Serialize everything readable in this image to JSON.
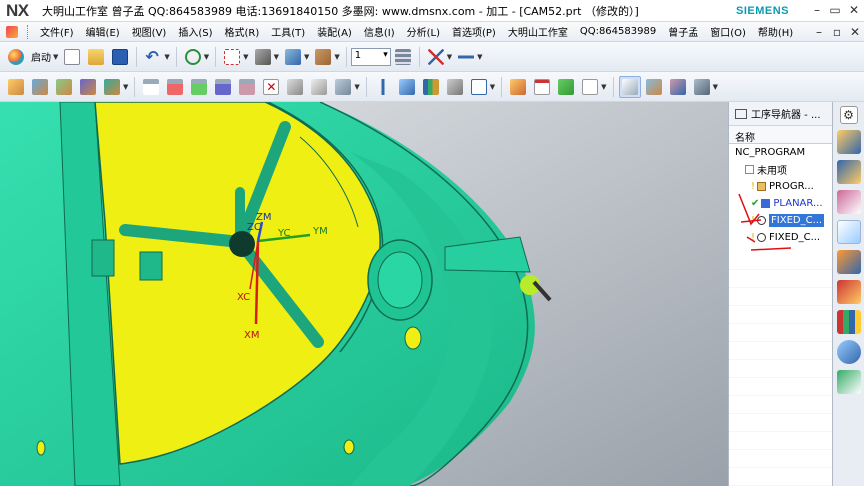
{
  "titlebar": {
    "logo": "NX",
    "title": "大明山工作室 曾子孟 QQ:864583989 电话:13691840150 多墨网: www.dmsnx.com - 加工 - [CAM52.prt （修改的）]",
    "brand": "SIEMENS",
    "min": "–",
    "restore": "▭",
    "close": "✕"
  },
  "menubar": {
    "items": [
      "文件(F)",
      "编辑(E)",
      "视图(V)",
      "插入(S)",
      "格式(R)",
      "工具(T)",
      "装配(A)",
      "信息(I)",
      "分析(L)",
      "首选项(P)",
      "大明山工作室",
      "QQ:864583989",
      "曾子孟",
      "窗口(O)",
      "帮助(H)"
    ],
    "win_min": "–",
    "win_restore": "▫",
    "win_close": "✕"
  },
  "toolbar": {
    "start_label": "启动",
    "layer_value": "1"
  },
  "viewport": {
    "axes": {
      "zm": "ZM",
      "zc": "ZC",
      "yc": "YC",
      "ym": "YM",
      "xc": "XC",
      "xm": "XM"
    }
  },
  "navigator": {
    "title": "工序导航器 - ...",
    "column": "名称",
    "items": [
      {
        "label": "NC_PROGRAM",
        "level": 0,
        "color": "#000000"
      },
      {
        "label": "未用项",
        "level": 1,
        "color": "#000000"
      },
      {
        "label": "PROGR...",
        "level": 2,
        "color": "#000000"
      },
      {
        "label": "PLANAR...",
        "level": 2,
        "color": "#1a33cc"
      },
      {
        "label": "FIXED_C...",
        "level": 2,
        "color": "#ffffff",
        "selected": true
      },
      {
        "label": "FIXED_C...",
        "level": 2,
        "color": "#000000"
      }
    ]
  },
  "colors": {
    "model": "#28d6a4",
    "floor": "#f2f21a",
    "selection": "#3276d8",
    "annotation": "#e01010",
    "brand": "#0b9bb0"
  }
}
